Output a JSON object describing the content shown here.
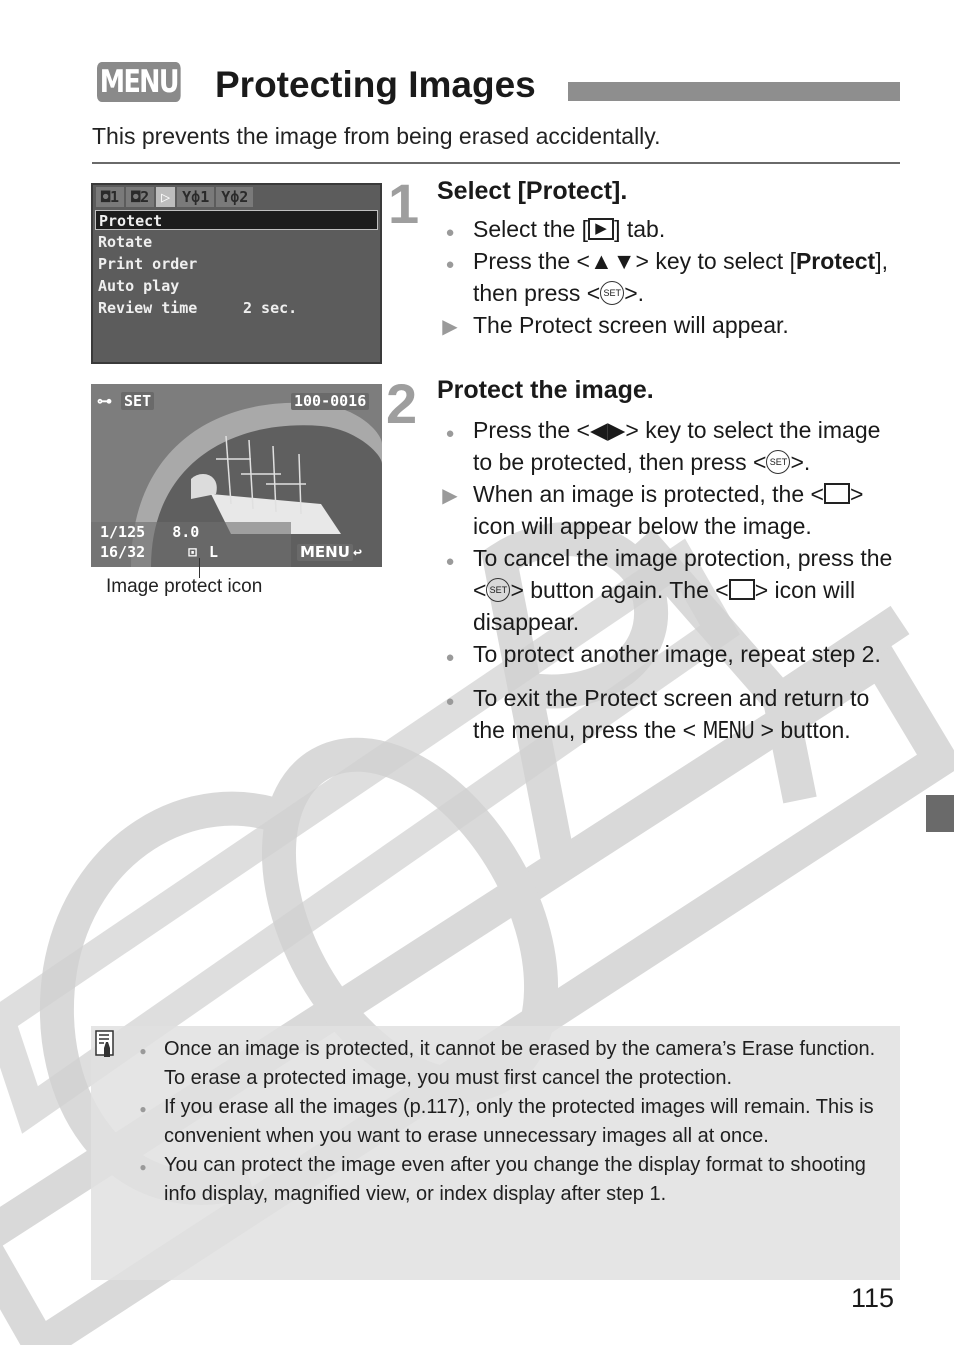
{
  "header": {
    "menu_badge": "MENU",
    "title": "Protecting Images",
    "intro": "This prevents the image from being erased accidentally."
  },
  "camera_menu": {
    "tabs": [
      {
        "icon": "camera-1-icon",
        "label": "◘1"
      },
      {
        "icon": "camera-2-icon",
        "label": "◘2"
      },
      {
        "icon": "playback-tab-icon",
        "label": "▷"
      },
      {
        "icon": "setup-1-icon",
        "label": "Υф1"
      },
      {
        "icon": "setup-2-icon",
        "label": "Υф2"
      }
    ],
    "items": [
      {
        "label": "Protect",
        "value": "",
        "selected": true
      },
      {
        "label": "Rotate",
        "value": ""
      },
      {
        "label": "Print order",
        "value": ""
      },
      {
        "label": "Auto play",
        "value": ""
      },
      {
        "label": "Review time",
        "value": "2 sec."
      }
    ]
  },
  "photo": {
    "top_left_label": "SET",
    "file_number": "100-0016",
    "shutter_aperture": "1/125   8.0",
    "frame_count": "16/32",
    "quality": "L",
    "menu_label": "MENU",
    "caption": "Image protect icon"
  },
  "steps": [
    {
      "number": "1",
      "title": "Select [Protect].",
      "bullets": [
        {
          "type": "dot",
          "parts": [
            "Select the [",
            "] tab."
          ]
        },
        {
          "type": "dot",
          "parts": [
            "Press the <",
            "> key to select [",
            "Protect",
            "], then press <",
            ">."
          ],
          "key": "▲▼"
        },
        {
          "type": "result",
          "text": "The Protect screen will appear."
        }
      ]
    },
    {
      "number": "2",
      "title": "Protect the image.",
      "bullets": [
        {
          "type": "dot",
          "parts": [
            "Press the <",
            "> key to select the image to be protected, then press <",
            ">."
          ],
          "key": "◀▶"
        },
        {
          "type": "result",
          "parts": [
            "When an image is protected, the <",
            "> icon will appear below the image."
          ]
        },
        {
          "type": "dot",
          "parts": [
            "To cancel the image protection, press the <",
            "> button again. The <",
            "> icon will disappear."
          ]
        },
        {
          "type": "dot",
          "text": "To protect another image, repeat step 2."
        },
        {
          "type": "dot",
          "parts": [
            "To exit the Protect screen and return to the menu, press the <",
            "> button."
          ],
          "menu": "MENU"
        }
      ]
    }
  ],
  "set_icon_label": "SET",
  "notes": [
    "Once an image is protected, it cannot be erased by the camera’s Erase function. To erase a protected image, you must first cancel the protection.",
    "If you erase all the images (p.117), only the protected images will remain. This is convenient when you want to erase unnecessary images all at once.",
    "You can protect the image even after you change the display format to shooting info display, magnified view, or index display after step 1."
  ],
  "watermark": "COPY",
  "page_number": "115"
}
